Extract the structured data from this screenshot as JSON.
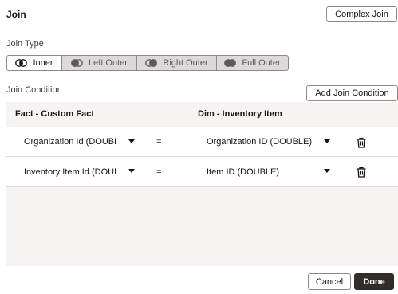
{
  "dialog": {
    "title": "Join",
    "complex_join_label": "Complex Join"
  },
  "join_type": {
    "label": "Join Type",
    "options": [
      "Inner",
      "Left Outer",
      "Right Outer",
      "Full Outer"
    ],
    "selected": "Inner"
  },
  "join_condition": {
    "label": "Join Condition",
    "add_label": "Add Join Condition",
    "left_header": "Fact - Custom Fact",
    "right_header": "Dim - Inventory Item",
    "rows": [
      {
        "left": "Organization Id (DOUBL",
        "op": "=",
        "right": "Organization ID (DOUBLE)"
      },
      {
        "left": "Inventory Item Id (DOUE",
        "op": "=",
        "right": "Item ID (DOUBLE)"
      }
    ]
  },
  "footer": {
    "cancel_label": "Cancel",
    "done_label": "Done"
  },
  "colors": {
    "primary_button": "#312d2a",
    "table_bg": "#f5f4f2",
    "selected_segment": "#ffffff"
  },
  "icons": {
    "venn": "venn-icon",
    "caret": "chevron-down-icon",
    "delete": "trash-icon"
  }
}
